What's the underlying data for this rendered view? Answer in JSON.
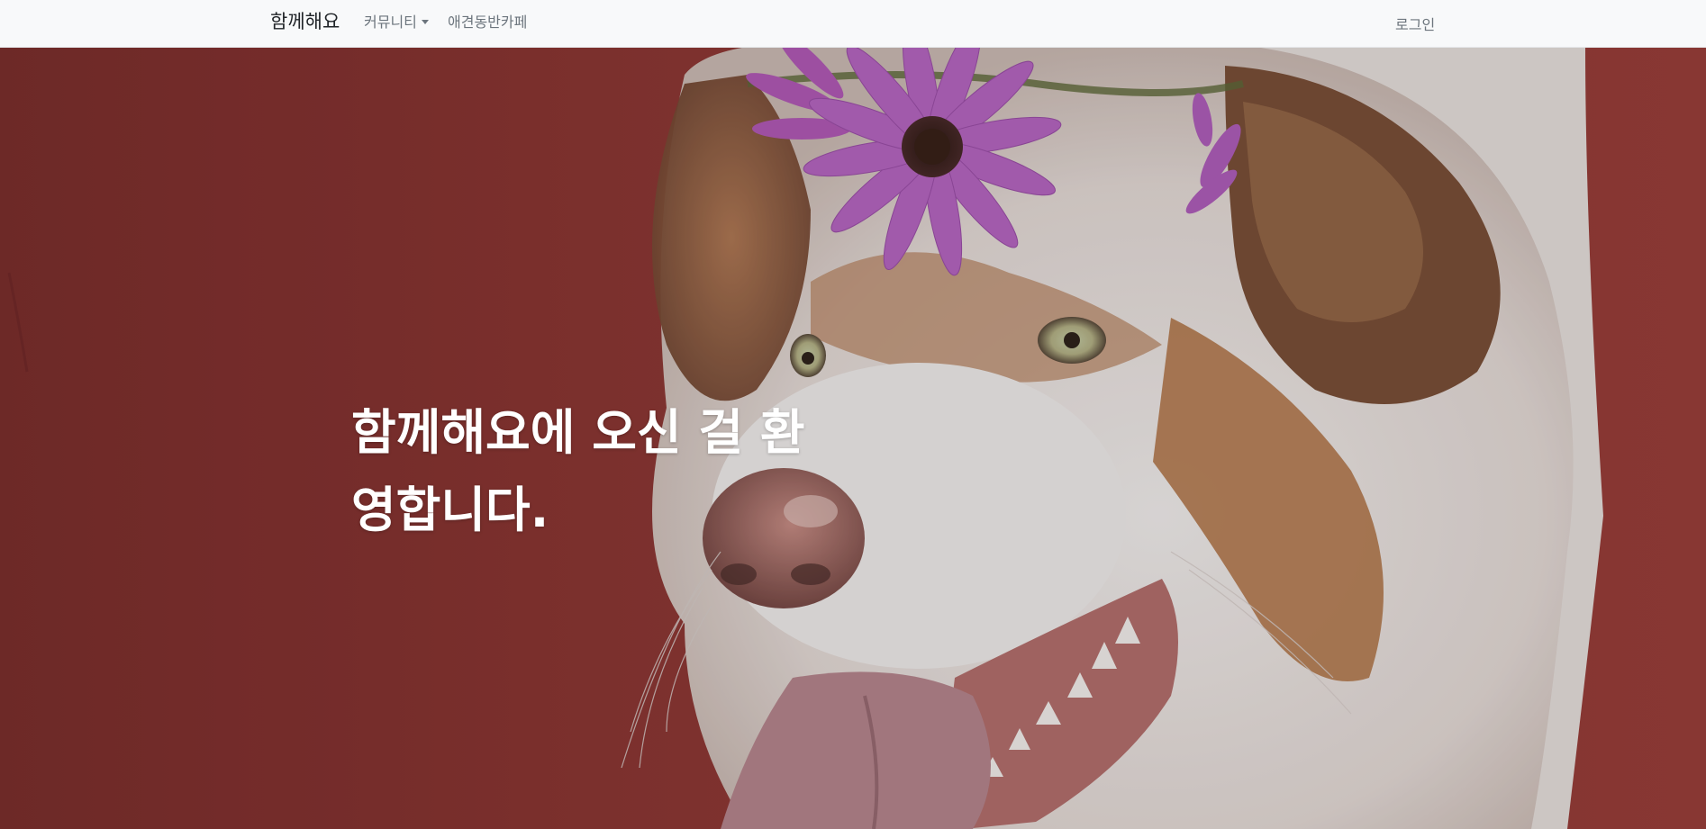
{
  "navbar": {
    "brand": "함께해요",
    "items": [
      {
        "label": "커뮤니티",
        "dropdown": true
      },
      {
        "label": "애견동반카페",
        "dropdown": false
      }
    ],
    "login_label": "로그인"
  },
  "hero": {
    "title": "함께해요에 오신 걸 환영합니다.",
    "image_icon": "dog-with-flower-crown-photo"
  },
  "colors": {
    "navbar_bg": "#f8f9fa",
    "hero_bg": "#8e3734",
    "hero_text": "#ffffff",
    "nav_text": "#6c757d"
  }
}
